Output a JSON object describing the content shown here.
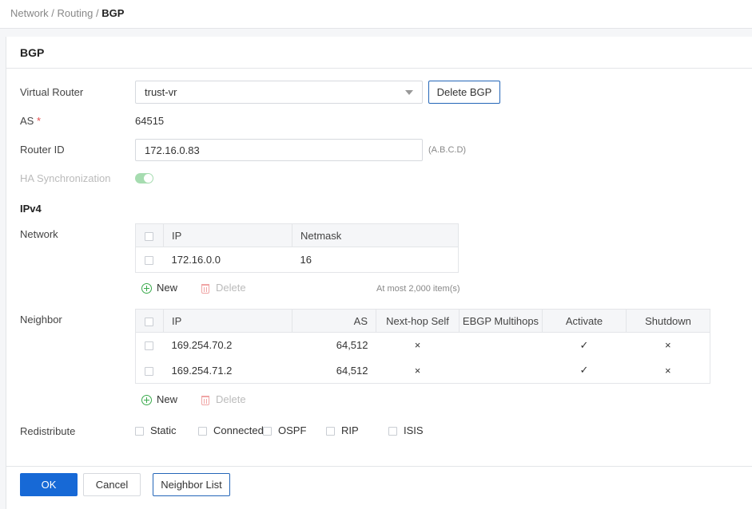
{
  "breadcrumb": {
    "path": [
      "Network",
      "Routing"
    ],
    "sep": " / ",
    "current": "BGP"
  },
  "panel": {
    "title": "BGP"
  },
  "form": {
    "virtual_router_label": "Virtual Router",
    "virtual_router_value": "trust-vr",
    "delete_bgp_label": "Delete BGP",
    "as_label": "AS",
    "as_required_mark": "*",
    "as_value": "64515",
    "router_id_label": "Router ID",
    "router_id_value": "172.16.0.83",
    "router_id_hint": "(A.B.C.D)",
    "ha_sync_label": "HA Synchronization",
    "ha_sync_on": true,
    "ipv4_section": "IPv4",
    "network_label": "Network",
    "neighbor_label": "Neighbor",
    "redistribute_label": "Redistribute"
  },
  "network_table": {
    "columns": [
      "IP",
      "Netmask"
    ],
    "rows": [
      {
        "ip": "172.16.0.0",
        "netmask": "16"
      }
    ],
    "new_label": "New",
    "delete_label": "Delete",
    "limit_note": "At most 2,000 item(s)"
  },
  "neighbor_table": {
    "columns": [
      "IP",
      "AS",
      "Next-hop Self",
      "EBGP Multihops",
      "Activate",
      "Shutdown"
    ],
    "rows": [
      {
        "ip": "169.254.70.2",
        "as": "64,512",
        "next_hop_self": "×",
        "ebgp_multihops": "",
        "activate": "✓",
        "shutdown": "×"
      },
      {
        "ip": "169.254.71.2",
        "as": "64,512",
        "next_hop_self": "×",
        "ebgp_multihops": "",
        "activate": "✓",
        "shutdown": "×"
      }
    ],
    "new_label": "New",
    "delete_label": "Delete"
  },
  "redistribute": {
    "options": [
      {
        "label": "Static",
        "checked": false
      },
      {
        "label": "Connected",
        "checked": false
      },
      {
        "label": "OSPF",
        "checked": false
      },
      {
        "label": "RIP",
        "checked": false
      },
      {
        "label": "ISIS",
        "checked": false
      }
    ]
  },
  "footer": {
    "ok_label": "OK",
    "cancel_label": "Cancel",
    "neighbor_list_label": "Neighbor List"
  },
  "colors": {
    "primary": "#1769d6",
    "toggle_on": "#a6dcb0",
    "required": "#e34d4d",
    "add_icon": "#3aaa4c",
    "delete_icon": "#f0a5a5"
  }
}
